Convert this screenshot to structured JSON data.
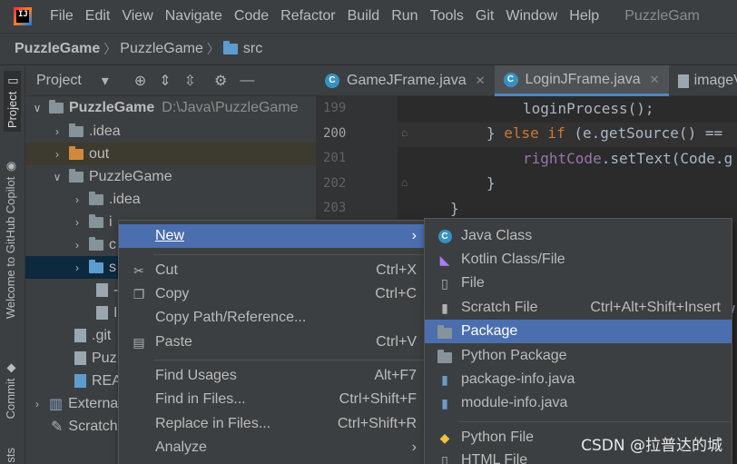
{
  "menubar": {
    "logo": "IJ",
    "items": [
      "File",
      "Edit",
      "View",
      "Navigate",
      "Code",
      "Refactor",
      "Build",
      "Run",
      "Tools",
      "Git",
      "Window",
      "Help"
    ],
    "title": "PuzzleGam"
  },
  "breadcrumb": [
    "PuzzleGame",
    "PuzzleGame",
    "src"
  ],
  "leftstrip": {
    "tabs": [
      "Project",
      "Welcome to GitHub Copilot",
      "Commit",
      "sts"
    ]
  },
  "project": {
    "title": "Project",
    "root": {
      "name": "PuzzleGame",
      "path": "D:\\Java\\PuzzleGame"
    },
    "rows": [
      ".idea",
      "out",
      "PuzzleGame",
      ".idea",
      "i",
      "c",
      "s",
      "-",
      "I",
      ".git",
      "Puz",
      "REA",
      "Externa",
      "Scratch"
    ]
  },
  "editor": {
    "tabs": [
      "GameJFrame.java",
      "LoginJFrame.java",
      "imageV"
    ],
    "line_numbers": [
      "199",
      "200",
      "201",
      "202",
      "203"
    ],
    "code": {
      "l199": "loginProcess();",
      "l200_a": "} ",
      "l200_kw": "else if",
      "l200_b": " (e.getSource() ==",
      "l201_fld": "rightCode",
      "l201_b": ".setText(Code.g",
      "l202": "}",
      "l203": "}",
      "l_extra": "w"
    }
  },
  "context_menu": {
    "items": [
      {
        "label": "New",
        "shortcut": ""
      },
      {
        "label": "Cut",
        "shortcut": "Ctrl+X"
      },
      {
        "label": "Copy",
        "shortcut": "Ctrl+C"
      },
      {
        "label": "Copy Path/Reference...",
        "shortcut": ""
      },
      {
        "label": "Paste",
        "shortcut": "Ctrl+V"
      },
      {
        "label": "Find Usages",
        "shortcut": "Alt+F7"
      },
      {
        "label": "Find in Files...",
        "shortcut": "Ctrl+Shift+F"
      },
      {
        "label": "Replace in Files...",
        "shortcut": "Ctrl+Shift+R"
      },
      {
        "label": "Analyze",
        "shortcut": ""
      }
    ]
  },
  "submenu": {
    "items": [
      {
        "label": "Java Class",
        "shortcut": ""
      },
      {
        "label": "Kotlin Class/File",
        "shortcut": ""
      },
      {
        "label": "File",
        "shortcut": ""
      },
      {
        "label": "Scratch File",
        "shortcut": "Ctrl+Alt+Shift+Insert"
      },
      {
        "label": "Package",
        "shortcut": ""
      },
      {
        "label": "Python Package",
        "shortcut": ""
      },
      {
        "label": "package-info.java",
        "shortcut": ""
      },
      {
        "label": "module-info.java",
        "shortcut": ""
      },
      {
        "label": "Python File",
        "shortcut": ""
      },
      {
        "label": "HTML File",
        "shortcut": ""
      }
    ]
  },
  "watermark": "CSDN @拉普达的城",
  "colors": {
    "highlight": "#4b6eaf",
    "background": "#2b2b2b",
    "panel": "#3c3f41"
  }
}
